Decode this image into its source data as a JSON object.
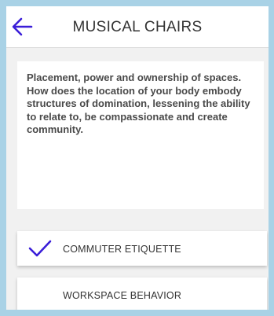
{
  "header": {
    "title": "MUSICAL CHAIRS",
    "back_icon": "arrow-left-icon"
  },
  "description": "Placement, power and ownership of spaces. How does the location of your body embody structures of domination, lessening the ability to relate to, be compassionate and create community.",
  "options": [
    {
      "label": "COMMUTER ETIQUETTE",
      "checked": true
    },
    {
      "label": "WORKSPACE BEHAVIOR",
      "checked": false
    }
  ],
  "colors": {
    "accent": "#3a1ed8",
    "background": "#f1f1f1",
    "frame": "#a9d2e6"
  }
}
